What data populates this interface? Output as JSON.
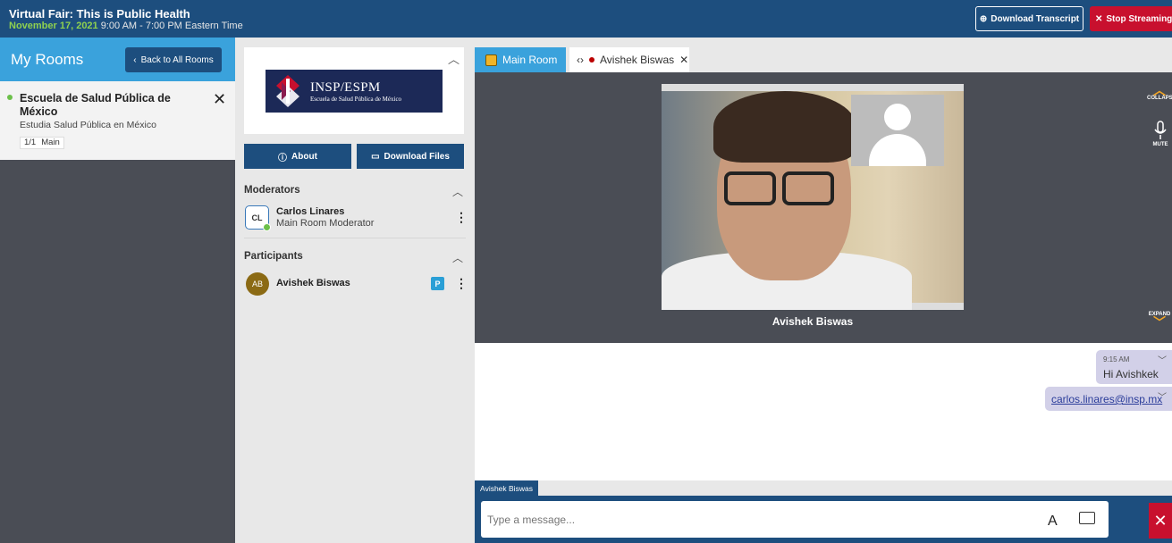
{
  "header": {
    "title": "Virtual Fair: This is Public Health",
    "date": "November 17, 2021",
    "time": "9:00 AM - 7:00 PM Eastern Time",
    "download_transcript_label": "Download Transcript",
    "stop_streaming_label": "Stop Streaming"
  },
  "rooms": {
    "heading": "My Rooms",
    "back_label": "Back to All Rooms",
    "active_room": {
      "name": "Escuela de Salud Pública de México",
      "subtitle": "Estudia Salud Pública en México",
      "count": "1/1",
      "room_label": "Main"
    }
  },
  "booth": {
    "logo_title": "INSP/ESPM",
    "logo_subtitle": "Escuela de Salud Pública de México",
    "about_label": "About",
    "download_files_label": "Download Files",
    "moderators_heading": "Moderators",
    "moderator": {
      "initials": "CL",
      "name": "Carlos Linares",
      "role": "Main Room Moderator"
    },
    "participants_heading": "Participants",
    "participant": {
      "initials": "AB",
      "name": "Avishek Biswas",
      "badge": "P"
    }
  },
  "tabs": {
    "main_room": "Main Room",
    "user_tab": "Avishek Biswas"
  },
  "video": {
    "name_label": "Avishek Biswas",
    "collapse_label": "COLLAPSE",
    "mute_label": "MUTE",
    "expand_label": "EXPAND"
  },
  "chat": {
    "messages": [
      {
        "time": "9:15 AM",
        "text": "Hi Avishkek"
      },
      {
        "text": "carlos.linares@insp.mx"
      }
    ]
  },
  "composer": {
    "tab_label": "Avishek Biswas",
    "placeholder": "Type a message..."
  },
  "colors": {
    "header_bg": "#1d4e7e",
    "accent_blue": "#3aa2dc",
    "stop_red": "#c8102e",
    "online_green": "#6cc04a"
  }
}
